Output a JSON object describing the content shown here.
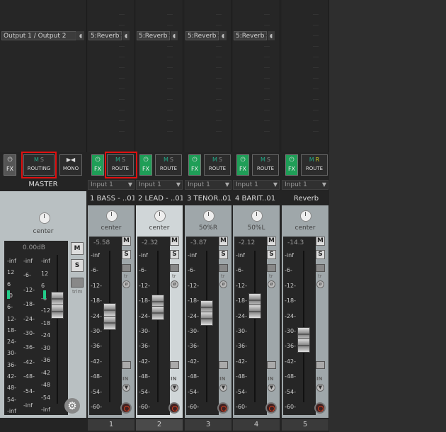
{
  "master": {
    "output_label": "Output 1 / Output 2",
    "fx_label": "FX",
    "routing_label": "ROUTING",
    "mono_label": "MONO",
    "name": "MASTER",
    "pan": "center",
    "peak": "0.00dB",
    "scale_left": [
      "-inf",
      "12",
      "6",
      "-0",
      "6-",
      "12-",
      "18-",
      "24-",
      "30-",
      "36-",
      "42-",
      "48-",
      "54-",
      "-inf"
    ],
    "scale_mid": [
      "-inf",
      "-6-",
      "-12-",
      "-18-",
      "-24-",
      "-30-",
      "-36-",
      "-42-",
      "-48-",
      "-54-",
      "-inf"
    ],
    "scale_right": [
      "-inf",
      "12",
      "6",
      "-6",
      "-12",
      "-18",
      "-24",
      "-30",
      "-36",
      "-42",
      "-48",
      "-54",
      "-inf"
    ],
    "m": "M",
    "s": "S",
    "trim": "trim"
  },
  "tracks": [
    {
      "insert": "5:Reverb",
      "input": "Input 1",
      "name": "1 BASS - ..01",
      "pan": "center",
      "peak": "-5.58",
      "number": "1",
      "route": "ROUTE",
      "fx": "FX"
    },
    {
      "insert": "5:Reverb",
      "input": "Input 1",
      "name": "2 LEAD - ..01",
      "pan": "center",
      "peak": "-2.32",
      "number": "2",
      "route": "ROUTE",
      "fx": "FX"
    },
    {
      "insert": "5:Reverb",
      "input": "Input 1",
      "name": "3 TENOR..01",
      "pan": "50%R",
      "peak": "-3.87",
      "number": "3",
      "route": "ROUTE",
      "fx": "FX"
    },
    {
      "insert": "5:Reverb",
      "input": "Input 1",
      "name": "4 BARIT..01",
      "pan": "50%L",
      "peak": "-2.12",
      "number": "4",
      "route": "ROUTE",
      "fx": "FX"
    },
    {
      "insert": "",
      "input": "Input 1",
      "name": "Reverb",
      "pan": "center",
      "peak": "-14.3",
      "number": "5",
      "route": "ROUTE",
      "fx": "FX"
    }
  ],
  "track_scale": [
    "-inf",
    "-6-",
    "-12-",
    "-18-",
    "-24-",
    "-30-",
    "-36-",
    "-42-",
    "-48-",
    "-54-",
    "-60-"
  ],
  "labels": {
    "m": "M",
    "s": "S",
    "msr": "M S",
    "tr": "tr",
    "in": "IN"
  },
  "colors": {
    "fx_on": "#1f9e57",
    "highlight": "#e01010"
  }
}
